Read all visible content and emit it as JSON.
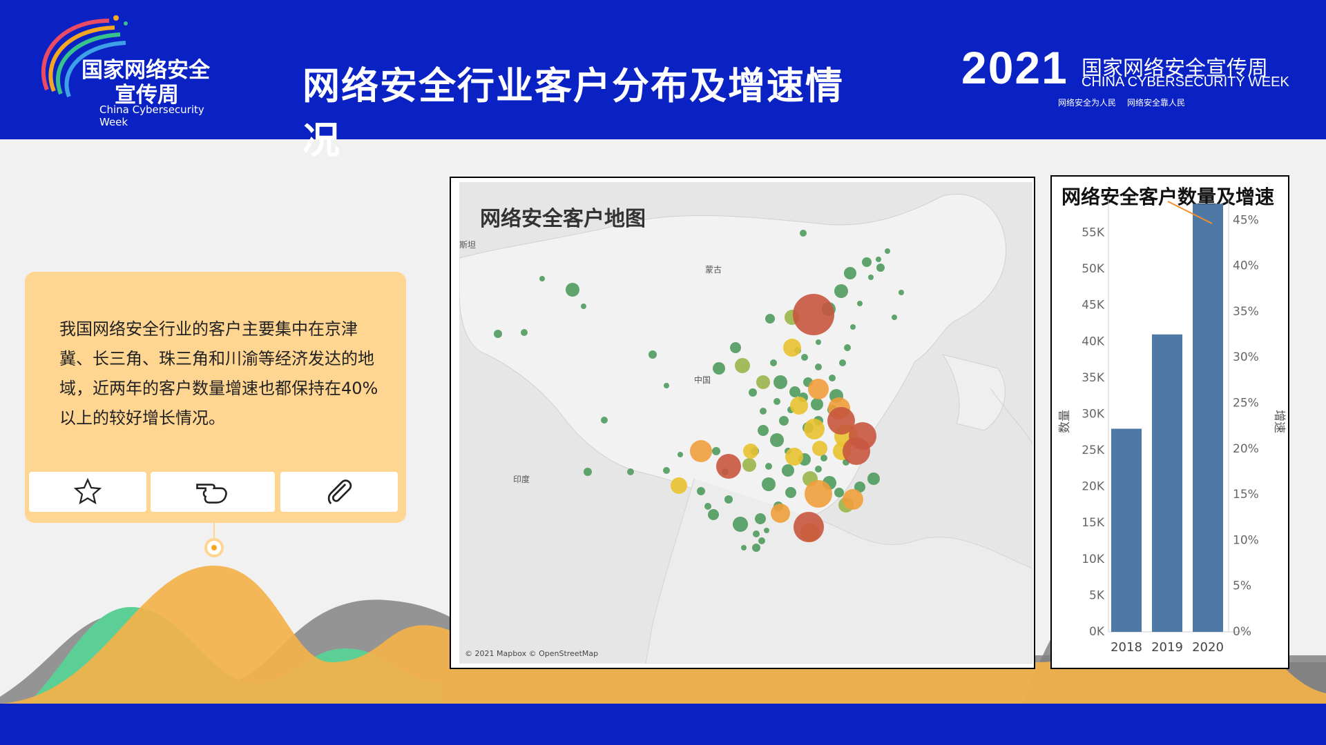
{
  "header": {
    "title": "网络安全行业客户分布及增速情况",
    "logo_left_line1": "国家网络安全",
    "logo_left_line2": "宣传周",
    "logo_left_en": "China Cybersecurity Week",
    "logo_right_year": "2021",
    "logo_right_cn": "国家网络安全宣传周",
    "logo_right_en": "CHINA CYBERSECURITY WEEK",
    "logo_right_slogan1": "网络安全为人民",
    "logo_right_slogan2": "网络安全靠人民"
  },
  "callout": {
    "text": "我国网络安全行业的客户主要集中在京津冀、长三角、珠三角和川渝等经济发达的地域，近两年的客户数量增速也都保持在40%以上的较好增长情况。",
    "buttons": [
      {
        "name": "star",
        "icon": "star-icon"
      },
      {
        "name": "pointer",
        "icon": "hand-pointer-icon"
      },
      {
        "name": "attach",
        "icon": "paperclip-icon"
      }
    ]
  },
  "map": {
    "title": "网络安全客户地图",
    "credit": "© 2021 Mapbox © OpenStreetMap",
    "labels": {
      "mongolia": "蒙古",
      "china": "中国",
      "india": "印度",
      "kazakh": "斯坦"
    },
    "colors": {
      "green": "#4f9a5e",
      "yellowgreen": "#9ab54a",
      "yellow": "#e8c230",
      "orange": "#ef9f3b",
      "red": "#c8573f"
    }
  },
  "chart_data": {
    "type": "bar",
    "title": "网络安全客户数量及增速",
    "categories": [
      "2018",
      "2019",
      "2020"
    ],
    "series": [
      {
        "values": [
          28000,
          41000,
          59000
        ]
      }
    ],
    "ylabel": "数量",
    "y2label": "增速",
    "ylim": [
      0,
      58000
    ],
    "y2lim": [
      0,
      0.46
    ],
    "yticks": [
      "0K",
      "5K",
      "10K",
      "15K",
      "20K",
      "25K",
      "30K",
      "35K",
      "40K",
      "45K",
      "50K",
      "55K"
    ],
    "y2ticks": [
      "0%",
      "5%",
      "10%",
      "15%",
      "20%",
      "25%",
      "30%",
      "35%",
      "40%",
      "45%"
    ],
    "bar_color": "#4e79a7",
    "line_color": "#f28e2b"
  }
}
